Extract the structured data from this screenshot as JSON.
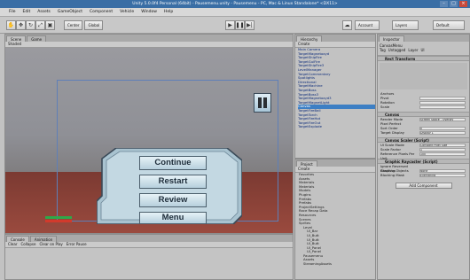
{
  "window": {
    "title": "Unity 5.0.0f4 Personal (64bit) - Pausemenu.unity - Pausemenu - PC, Mac & Linux Standalone* <DX11>"
  },
  "menubar": {
    "items": [
      "File",
      "Edit",
      "Assets",
      "GameObject",
      "Component",
      "Vehicle",
      "Window",
      "Help"
    ]
  },
  "toolbar": {
    "pivot_label": "Center",
    "space_label": "Global",
    "account_label": "Account",
    "layers_label": "Layers",
    "layout_label": "Default"
  },
  "scene": {
    "tabs": [
      "Scene",
      "Game"
    ],
    "shading_mode": "Shaded",
    "pause_menu": {
      "buttons": [
        "Continue",
        "Restart",
        "Review",
        "Menu"
      ]
    }
  },
  "console": {
    "tabs": [
      "Console",
      "Animation"
    ],
    "toolbar_items": [
      "Clear",
      "Collapse",
      "Clear on Play",
      "Error Pause"
    ]
  },
  "hierarchy": {
    "tab": "Hierarchy",
    "create_label": "Create",
    "items": [
      "Main Camera",
      "TargetMagnetoxyd",
      "TargetShipFire",
      "TargetGuiFire",
      "TargetShipFire3",
      "LevelManager",
      "TargetCommentary",
      "Spotlights",
      "Directional",
      "TargetMachine",
      "TargetBoss",
      "TargetBoss3",
      "TargetMagnetoxyd3",
      "TargetMagnetLight",
      "Canvas",
      "TargetFireBall",
      "TargetTorch",
      "TargetFireHot",
      "TargetFireOut",
      "TargetExplode"
    ],
    "selected_index": 14
  },
  "project": {
    "tab": "Project",
    "create_label": "Create",
    "items": [
      "Favorites",
      "Assets",
      "Materials",
      "Materials",
      "Models",
      "Plugins",
      "Prefabs",
      "Prefabs",
      "ProjectSettings",
      "Race Recap Data",
      "Resources",
      "Scenes",
      "Sprites",
      "Level",
      "UI_Bar",
      "UI_Butt",
      "UI_Butt",
      "UI_Butt",
      "UI_Panel",
      "UI_Panel",
      "Pausemenu",
      "Assets",
      "StreamingAssets"
    ]
  },
  "inspector": {
    "tab": "Inspector",
    "object_name": "CanvasMenu",
    "tag_label": "Tag",
    "tag_value": "Untagged",
    "layer_label": "Layer",
    "layer_value": "UI",
    "static_label": "Static",
    "rect_transform": "Rect Transform",
    "anchors_label": "Anchors",
    "pivot_label": "Pivot",
    "rotation_label": "Rotation",
    "scale_label": "Scale",
    "canvas": "Canvas",
    "render_mode_label": "Render Mode",
    "render_mode_value": "Screen Space - Overlay",
    "pixel_perfect_label": "Pixel Perfect",
    "sort_order_label": "Sort Order",
    "sort_order_value": "0",
    "target_display_label": "Target Display",
    "target_display_value": "Display 1",
    "canvas_scaler": "Canvas Scaler (Script)",
    "ui_scale_mode_label": "UI Scale Mode",
    "ui_scale_mode_value": "Constant Pixel Size",
    "scale_factor_label": "Scale Factor",
    "scale_factor_value": "1",
    "ref_pixels_label": "Reference Pixels Per Unit",
    "ref_pixels_value": "100",
    "graphic_raycaster": "Graphic Raycaster (Script)",
    "ignore_reversed_label": "Ignore Reversed Graphics",
    "blocking_objects_label": "Blocking Objects",
    "blocking_objects_value": "None",
    "blocking_mask_label": "Blocking Mask",
    "blocking_mask_value": "Everything",
    "add_component_label": "Add Component"
  },
  "colors": {
    "titlebar": "#3a6ea5",
    "selection": "#3d7fc4",
    "menu_border": "#3a4a58"
  }
}
